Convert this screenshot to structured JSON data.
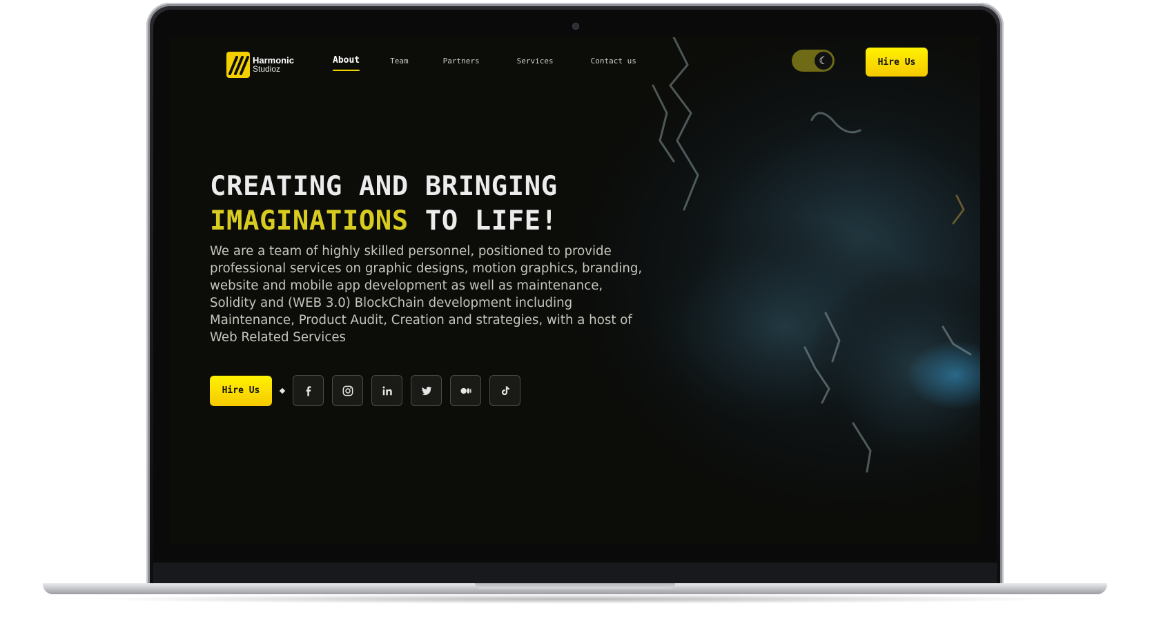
{
  "brand": {
    "name_line1": "Harmonic",
    "name_line2": "Studioz"
  },
  "nav": {
    "links": [
      {
        "label": "About",
        "active": true
      },
      {
        "label": "Team",
        "active": false
      },
      {
        "label": "Partners",
        "active": false
      },
      {
        "label": "Services",
        "active": false
      },
      {
        "label": "Contact us",
        "active": false
      }
    ]
  },
  "theme_toggle": {
    "icon": "moon-icon",
    "mode": "dark"
  },
  "header": {
    "cta_label": "Hire Us"
  },
  "hero": {
    "headline_line1": "CREATING AND BRINGING",
    "headline_highlight": "IMAGINATIONS",
    "headline_line2_rest": " TO LIFE!",
    "description": "We are a team of highly skilled personnel, positioned to provide professional services on graphic designs, motion graphics, branding, website and mobile app development as well as maintenance, Solidity and (WEB 3.0) BlockChain development including Maintenance, Product Audit, Creation and strategies, with a host of Web Related Services",
    "cta_label": "Hire Us"
  },
  "socials": [
    {
      "name": "facebook-icon"
    },
    {
      "name": "instagram-icon"
    },
    {
      "name": "linkedin-icon"
    },
    {
      "name": "twitter-icon"
    },
    {
      "name": "medium-icon"
    },
    {
      "name": "tiktok-icon"
    }
  ],
  "colors": {
    "accent": "#f2d600",
    "headline_highlight": "#d9cc20",
    "background": "#0d0d09"
  }
}
